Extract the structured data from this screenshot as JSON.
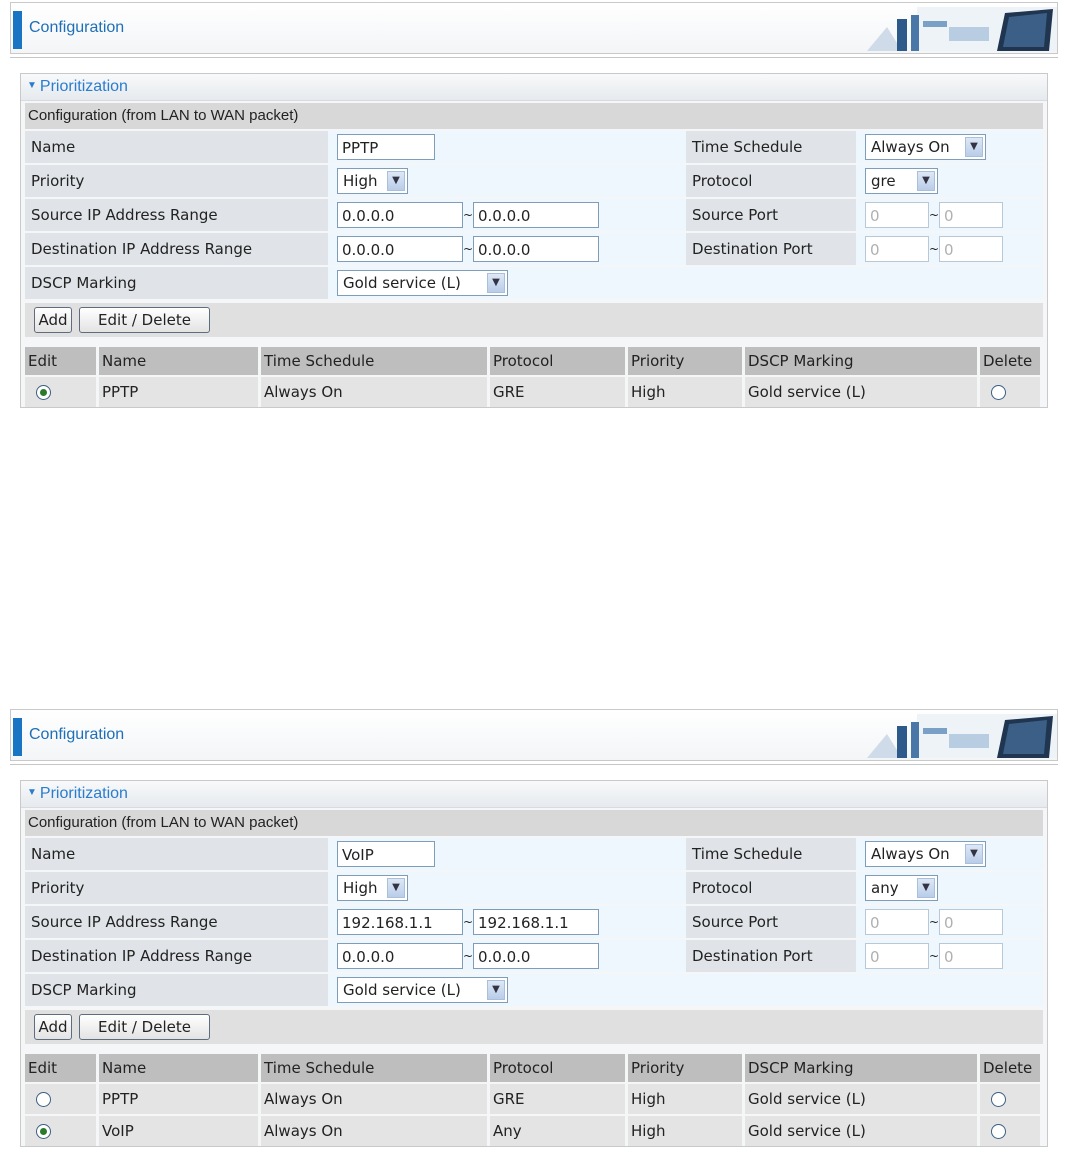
{
  "panels": [
    {
      "header_title": "Configuration",
      "section_title": "Prioritization",
      "subheader": "Configuration (from LAN to WAN packet)",
      "fields": {
        "name_label": "Name",
        "name_value": "PPTP",
        "time_schedule_label": "Time Schedule",
        "time_schedule_value": "Always On",
        "priority_label": "Priority",
        "priority_value": "High",
        "protocol_label": "Protocol",
        "protocol_value": "gre",
        "src_ip_label": "Source IP Address Range",
        "src_ip_start": "0.0.0.0",
        "src_ip_end": "0.0.0.0",
        "src_port_label": "Source Port",
        "src_port_start": "0",
        "src_port_end": "0",
        "dst_ip_label": "Destination IP Address Range",
        "dst_ip_start": "0.0.0.0",
        "dst_ip_end": "0.0.0.0",
        "dst_port_label": "Destination Port",
        "dst_port_start": "0",
        "dst_port_end": "0",
        "dscp_label": "DSCP Marking",
        "dscp_value": "Gold service (L)"
      },
      "buttons": {
        "add": "Add",
        "edit_delete": "Edit / Delete"
      },
      "table": {
        "headers": [
          "Edit",
          "Name",
          "Time Schedule",
          "Protocol",
          "Priority",
          "DSCP Marking",
          "Delete"
        ],
        "rows": [
          {
            "edit_selected": true,
            "name": "PPTP",
            "time_schedule": "Always On",
            "protocol": "GRE",
            "priority": "High",
            "dscp": "Gold service (L)"
          }
        ]
      }
    },
    {
      "header_title": "Configuration",
      "section_title": "Prioritization",
      "subheader": "Configuration (from LAN to WAN packet)",
      "fields": {
        "name_label": "Name",
        "name_value": "VoIP",
        "time_schedule_label": "Time Schedule",
        "time_schedule_value": "Always On",
        "priority_label": "Priority",
        "priority_value": "High",
        "protocol_label": "Protocol",
        "protocol_value": "any",
        "src_ip_label": "Source IP Address Range",
        "src_ip_start": "192.168.1.1",
        "src_ip_end": "192.168.1.1",
        "src_port_label": "Source Port",
        "src_port_start": "0",
        "src_port_end": "0",
        "dst_ip_label": "Destination IP Address Range",
        "dst_ip_start": "0.0.0.0",
        "dst_ip_end": "0.0.0.0",
        "dst_port_label": "Destination Port",
        "dst_port_start": "0",
        "dst_port_end": "0",
        "dscp_label": "DSCP Marking",
        "dscp_value": "Gold service (L)"
      },
      "buttons": {
        "add": "Add",
        "edit_delete": "Edit / Delete"
      },
      "table": {
        "headers": [
          "Edit",
          "Name",
          "Time Schedule",
          "Protocol",
          "Priority",
          "DSCP Marking",
          "Delete"
        ],
        "rows": [
          {
            "edit_selected": false,
            "name": "PPTP",
            "time_schedule": "Always On",
            "protocol": "GRE",
            "priority": "High",
            "dscp": "Gold service (L)"
          },
          {
            "edit_selected": true,
            "name": "VoIP",
            "time_schedule": "Always On",
            "protocol": "Any",
            "priority": "High",
            "dscp": "Gold service (L)"
          }
        ]
      }
    }
  ],
  "colors": {
    "accent": "#1a74c4",
    "section_text": "#2a7ccf"
  },
  "icons": {
    "section_toggle": "triangle-down-icon",
    "dropdown": "chevron-down-icon",
    "logo": "office-banner-image"
  }
}
